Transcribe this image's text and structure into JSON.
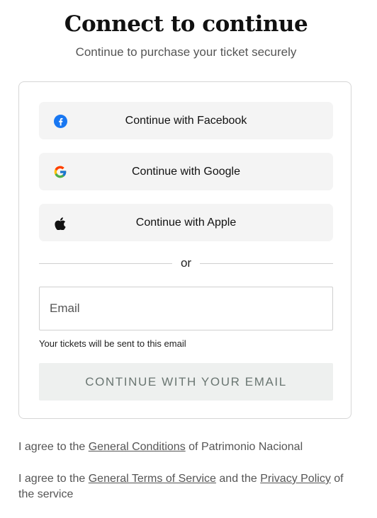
{
  "header": {
    "title": "Connect to continue",
    "subtitle": "Continue to purchase your ticket securely"
  },
  "social": {
    "facebook_label": "Continue with Facebook",
    "google_label": "Continue with Google",
    "apple_label": "Continue with Apple",
    "icons": [
      "facebook-icon",
      "google-icon",
      "apple-icon"
    ]
  },
  "divider": {
    "label": "or"
  },
  "email": {
    "placeholder": "Email",
    "value": "",
    "hint": "Your tickets will be sent to this email",
    "button_label": "CONTINUE WITH YOUR EMAIL"
  },
  "legal": {
    "line1_prefix": "I agree to the ",
    "line1_link": "General Conditions",
    "line1_suffix": " of Patrimonio Nacional",
    "line2_prefix": "I agree to the ",
    "line2_link1": "General Terms of Service",
    "line2_middle": " and the ",
    "line2_link2": "Privacy Policy",
    "line2_suffix": " of the service"
  },
  "colors": {
    "facebook": "#1877F2",
    "button_bg": "#f4f4f4",
    "email_button_bg": "#eef0ef",
    "email_button_text": "#6a7672"
  }
}
